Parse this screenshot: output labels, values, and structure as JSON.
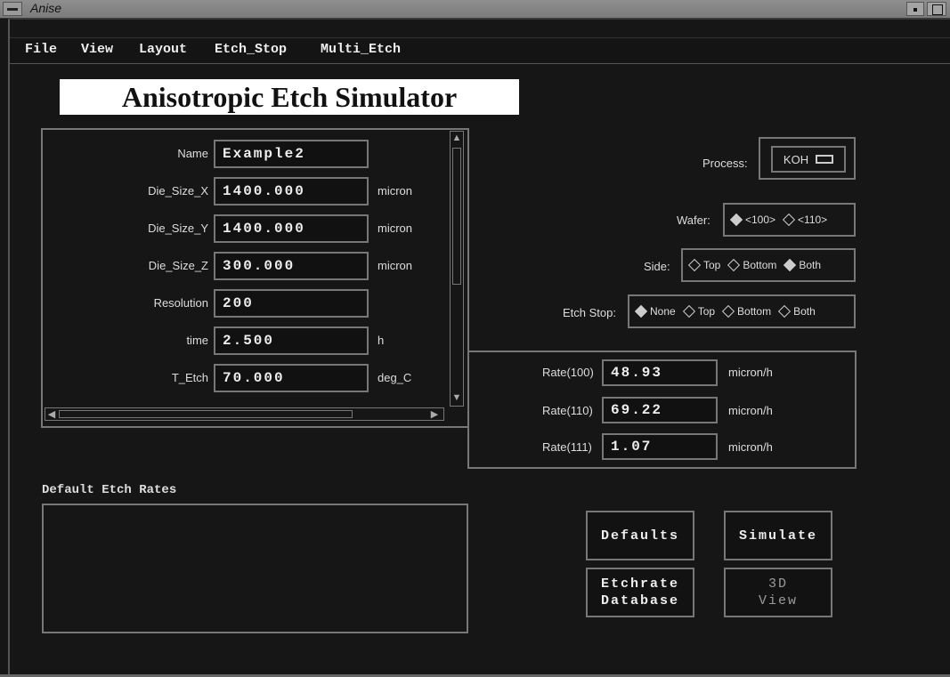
{
  "window": {
    "title": "Anise"
  },
  "menu": [
    "File",
    "View",
    "Layout",
    "Etch_Stop",
    "Multi_Etch"
  ],
  "app_title": "Anisotropic Etch Simulator",
  "params": [
    {
      "label": "Name",
      "value": "Example2",
      "unit": ""
    },
    {
      "label": "Die_Size_X",
      "value": "1400.000",
      "unit": "micron"
    },
    {
      "label": "Die_Size_Y",
      "value": "1400.000",
      "unit": "micron"
    },
    {
      "label": "Die_Size_Z",
      "value": "300.000",
      "unit": "micron"
    },
    {
      "label": "Resolution",
      "value": "200",
      "unit": ""
    },
    {
      "label": "time",
      "value": "2.500",
      "unit": "h"
    },
    {
      "label": "T_Etch",
      "value": "70.000",
      "unit": "deg_C"
    }
  ],
  "process": {
    "label": "Process:",
    "value": "KOH"
  },
  "wafer": {
    "label": "Wafer:",
    "options": [
      "<100>",
      "<110>"
    ],
    "selected": 0
  },
  "side": {
    "label": "Side:",
    "options": [
      "Top",
      "Bottom",
      "Both"
    ],
    "selected": 2
  },
  "etch_stop": {
    "label": "Etch Stop:",
    "options": [
      "None",
      "Top",
      "Bottom",
      "Both"
    ],
    "selected": 0
  },
  "rates": [
    {
      "label": "Rate(100)",
      "value": "48.93",
      "unit": "micron/h"
    },
    {
      "label": "Rate(110)",
      "value": "69.22",
      "unit": "micron/h"
    },
    {
      "label": "Rate(111)",
      "value": "1.07",
      "unit": "micron/h"
    }
  ],
  "default_rates": {
    "title": "Default Etch Rates"
  },
  "buttons": {
    "defaults": "Defaults",
    "simulate": "Simulate",
    "etchrate_db": "Etchrate\nDatabase",
    "view3d": "3D\nView"
  },
  "icons": {
    "scroll_up": "▲",
    "scroll_down": "▼",
    "scroll_left": "◀",
    "scroll_right": "▶"
  },
  "colors": {
    "background": "#161616",
    "border": "#777777",
    "title_bg": "#ffffff"
  }
}
